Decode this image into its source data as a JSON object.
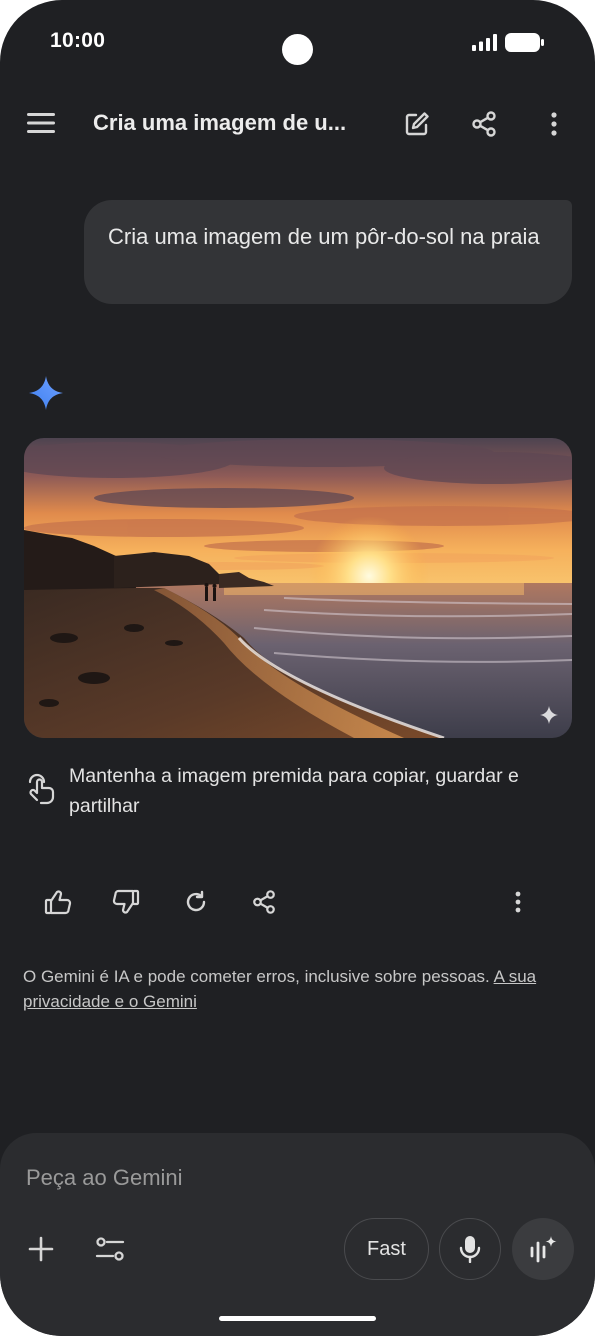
{
  "status_bar": {
    "time": "10:00"
  },
  "header": {
    "title": "Cria uma imagem de u...",
    "icons": [
      "menu-icon",
      "edit-icon",
      "share-icon",
      "more-vert-icon"
    ]
  },
  "user_message": {
    "text": "Cria uma imagem de um pôr-do-sol na praia"
  },
  "response": {
    "image_icon": "sparkle-watermark-icon",
    "hint": "Mantenha a imagem premida para copiar, guardar e partilhar",
    "actions": [
      "thumbs-up-icon",
      "thumbs-down-icon",
      "redo-icon",
      "share-icon",
      "more-vert-icon"
    ]
  },
  "disclaimer": {
    "text": "O Gemini é IA e pode cometer erros, inclusive sobre pessoas. ",
    "link": "A sua privacidade e o Gemini"
  },
  "composer": {
    "placeholder": "Peça ao Gemini",
    "mode_label": "Fast",
    "icons": [
      "add-icon",
      "tools-icon",
      "mic-icon",
      "live-icon"
    ]
  },
  "colors": {
    "background": "#1f2023",
    "bubble": "#333437",
    "composer": "#2b2c2f",
    "accent_blue": "#4c8df6"
  }
}
